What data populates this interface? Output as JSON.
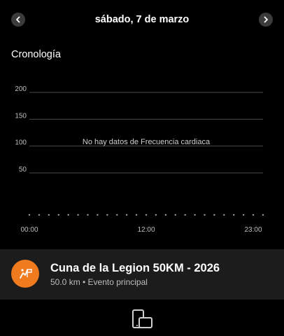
{
  "header": {
    "date": "sábado, 7 de marzo",
    "prev_icon": "chevron-left-icon",
    "next_icon": "chevron-right-icon"
  },
  "timeline": {
    "title": "Cronología",
    "no_data_message": "No hay datos de Frecuencia cardiaca"
  },
  "chart_data": {
    "type": "line",
    "ylabel": "",
    "xlabel": "",
    "y_ticks": [
      "200",
      "150",
      "100",
      "50"
    ],
    "y_tick_values": [
      200,
      150,
      100,
      50
    ],
    "ylim": [
      0,
      220
    ],
    "x_ticks": [
      "00:00",
      "12:00",
      "23:00"
    ],
    "series": [],
    "grid": true
  },
  "event": {
    "title": "Cuna de la Legion 50KM - 2026",
    "subtitle": "50.0 km • Evento principal",
    "icon": "race-flag-icon",
    "icon_color": "#f07b1e"
  },
  "footer": {
    "icon": "devices-icon"
  },
  "colors": {
    "background": "#000000",
    "card": "#1c1c1c",
    "accent": "#f07b1e"
  }
}
